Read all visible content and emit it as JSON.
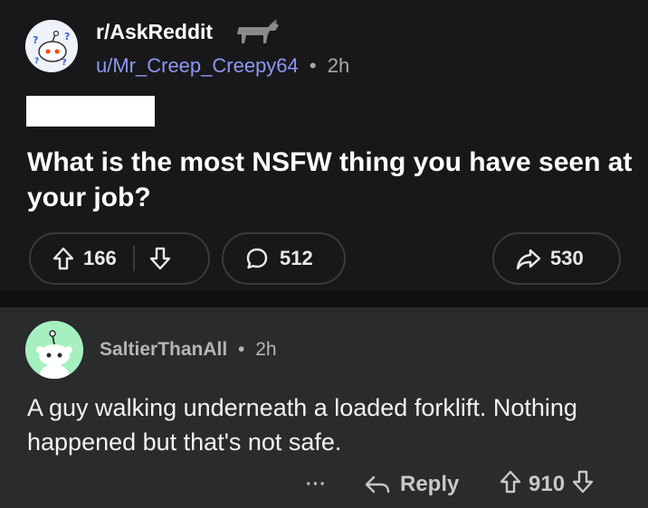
{
  "post": {
    "subreddit": "r/AskReddit",
    "username": "u/Mr_Creep_Creepy64",
    "separator": "•",
    "time": "2h",
    "title": "What is the most NSFW thing you have seen at your job?",
    "upvotes": "166",
    "comments": "512",
    "shares": "530"
  },
  "comment": {
    "username": "SaltierThanAll",
    "separator": "•",
    "time": "2h",
    "body": "A guy walking underneath a loaded forklift. Nothing happened but that's not safe.",
    "more": "···",
    "reply_label": "Reply",
    "votes": "910"
  },
  "icons": {
    "subreddit_avatar": "askreddit-snoo-icon",
    "flair": "horse-icon",
    "upvote": "upvote-arrow-icon",
    "downvote": "downvote-arrow-icon",
    "comment": "speech-bubble-icon",
    "share": "share-arrow-icon",
    "reply": "reply-arrow-icon",
    "user_avatar": "snoo-avatar-icon"
  },
  "colors": {
    "background": "#18181a",
    "comment_background": "#2a2b2d",
    "username_link": "#8d96f2",
    "user_avatar": "#a6f0c0"
  }
}
